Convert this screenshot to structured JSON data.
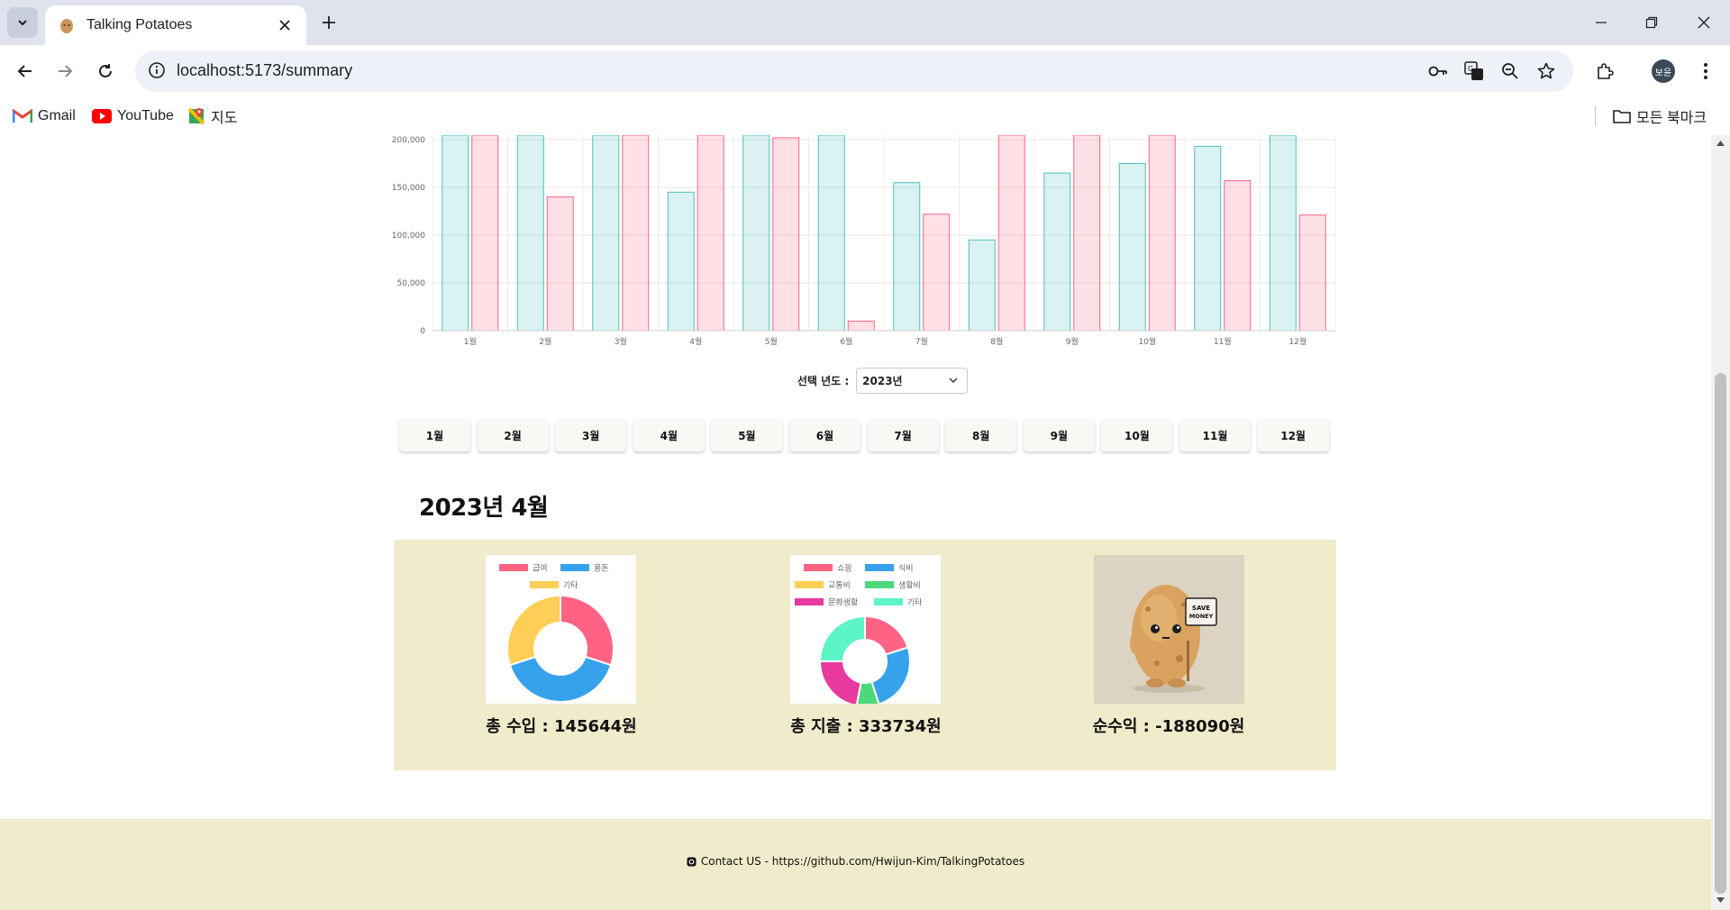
{
  "browser": {
    "tab_title": "Talking Potatoes",
    "url": "localhost:5173/summary",
    "profile_initials": "보윤",
    "bookmarks": [
      {
        "label": "Gmail",
        "icon": "gmail-icon"
      },
      {
        "label": "YouTube",
        "icon": "youtube-icon"
      },
      {
        "label": "지도",
        "icon": "maps-icon"
      }
    ],
    "all_bookmarks_label": "모든 북마크"
  },
  "chart_data": {
    "type": "bar",
    "categories": [
      "1월",
      "2월",
      "3월",
      "4월",
      "5월",
      "6월",
      "7월",
      "8월",
      "9월",
      "10월",
      "11월",
      "12월"
    ],
    "series": [
      {
        "values": [
          210000,
          210000,
          210000,
          145000,
          210000,
          210000,
          155000,
          95000,
          165000,
          175000,
          193000,
          210000
        ],
        "color": "#4bc0c0"
      },
      {
        "values": [
          210000,
          140000,
          210000,
          210000,
          202000,
          10000,
          122000,
          210000,
          210000,
          210000,
          157000,
          121000
        ],
        "color": "#ff6384"
      }
    ],
    "yticks": [
      "0",
      "50,000",
      "100,000",
      "150,000",
      "200,000"
    ],
    "ylim": [
      0,
      210000
    ],
    "grid": true
  },
  "year_select": {
    "label": "선택 년도 :",
    "value": "2023년"
  },
  "months": [
    "1월",
    "2월",
    "3월",
    "4월",
    "5월",
    "6월",
    "7월",
    "8월",
    "9월",
    "10월",
    "11월",
    "12월"
  ],
  "period_title": "2023년 4월",
  "income_chart": {
    "legend": [
      {
        "label": "급여",
        "color": "#ff6384"
      },
      {
        "label": "용돈",
        "color": "#36a2eb"
      },
      {
        "label": "기타",
        "color": "#ffce56"
      }
    ],
    "values": [
      30,
      40,
      30
    ]
  },
  "expense_chart": {
    "legend": [
      {
        "label": "쇼핑",
        "color": "#ff6384"
      },
      {
        "label": "식비",
        "color": "#36a2eb"
      },
      {
        "label": "교통비",
        "color": "#ffce56"
      },
      {
        "label": "생활비",
        "color": "#4bd97a"
      },
      {
        "label": "문화생활",
        "color": "#e8399e"
      },
      {
        "label": "기타",
        "color": "#5cf5c6"
      }
    ],
    "values": [
      20,
      25,
      0,
      8,
      22,
      25
    ]
  },
  "totals": {
    "income": "총 수입 : 145644원",
    "expense": "총 지출 : 333734원",
    "net": "순수익 : -188090원"
  },
  "mascot_sign": "SAVE MONEY",
  "footer": {
    "text": "Contact US - https://github.com/Hwijun-Kim/TalkingPotatoes"
  }
}
